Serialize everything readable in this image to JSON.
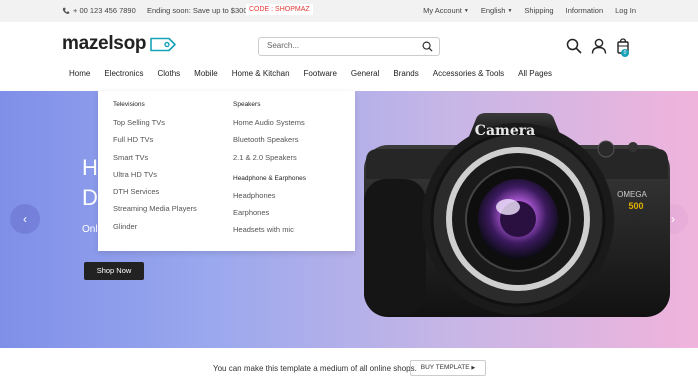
{
  "topbar": {
    "phone": "+ 00 123 456 7890",
    "promo": "Ending soon: Save up to $300!",
    "code": "CODE : SHOPMAZ",
    "my_account": "My Account",
    "language": "English",
    "shipping": "Shipping",
    "information": "Information",
    "login": "Log In"
  },
  "header": {
    "logo": "mazelsop",
    "search_placeholder": "Search...",
    "cart_count": "0"
  },
  "nav": {
    "items": [
      "Home",
      "Electronics",
      "Cloths",
      "Mobile",
      "Home & Kitchan",
      "Footware",
      "General",
      "Brands",
      "Accessories & Tools",
      "All Pages"
    ]
  },
  "dropdown": {
    "col1_title": "Televisions",
    "col1_items": [
      "Top Selling TVs",
      "Full HD TVs",
      "Smart TVs",
      "Ultra HD TVs",
      "DTH Services",
      "Streaming Media Players",
      "Glinder"
    ],
    "col2_title": "Speakers",
    "col2_items": [
      "Home Audio Systems",
      "Bluetooth Speakers",
      "2.1 & 2.0 Speakers"
    ],
    "col3_title": "Headphone & Earphones",
    "col3_items": [
      "Headphones",
      "Earphones",
      "Headsets with mic"
    ]
  },
  "hero": {
    "heading_line1": "H",
    "heading_line2": "D",
    "subtext": "Onl",
    "shop_button": "Shop Now",
    "camera_label": "Camera",
    "brand": "OMEGA",
    "model": "500"
  },
  "footer": {
    "message": "You can make this template a medium of all online shops.",
    "buy_button": "BUY TEMPLATE"
  }
}
